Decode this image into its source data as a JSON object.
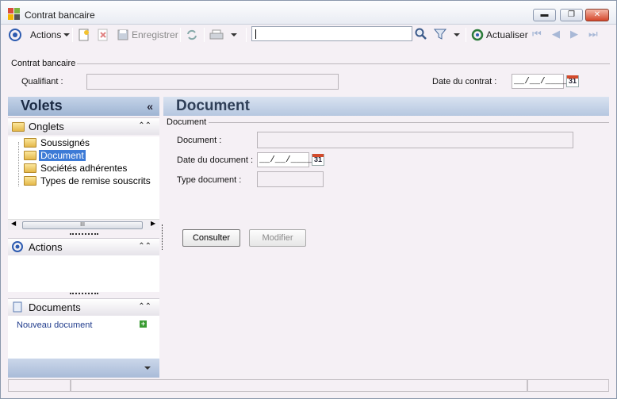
{
  "window": {
    "title": "Contrat bancaire",
    "controls": [
      "minimize",
      "maximize",
      "close"
    ]
  },
  "toolbar": {
    "actions_label": "Actions",
    "save_label": "Enregistrer",
    "search_value": "",
    "refresh_label": "Actualiser"
  },
  "header": {
    "group_title": "Contrat bancaire",
    "qualifiant_label": "Qualifiant :",
    "qualifiant_value": "",
    "date_label": "Date du contrat :",
    "date_value": "__/__/____",
    "calendar_day": "31"
  },
  "volets": {
    "title": "Volets",
    "onglets": {
      "title": "Onglets",
      "items": [
        {
          "label": "Soussignés",
          "selected": false
        },
        {
          "label": "Document",
          "selected": true
        },
        {
          "label": "Sociétés adhérentes",
          "selected": false
        },
        {
          "label": "Types de remise souscrits",
          "selected": false
        }
      ],
      "scroll_thumb": "III"
    },
    "actions": {
      "title": "Actions"
    },
    "documents": {
      "title": "Documents",
      "new_doc": "Nouveau document"
    }
  },
  "document": {
    "title": "Document",
    "group_title": "Document",
    "doc_label": "Document :",
    "doc_value": "",
    "date_label": "Date du document :",
    "date_value": "__/__/____",
    "calendar_day": "31",
    "type_label": "Type document :",
    "type_value": "",
    "consult_label": "Consulter",
    "modify_label": "Modifier"
  },
  "colors": {
    "accent": "#3d7bd6",
    "panel": "#f5f0f5",
    "header_blue": "#b6c7e0"
  }
}
